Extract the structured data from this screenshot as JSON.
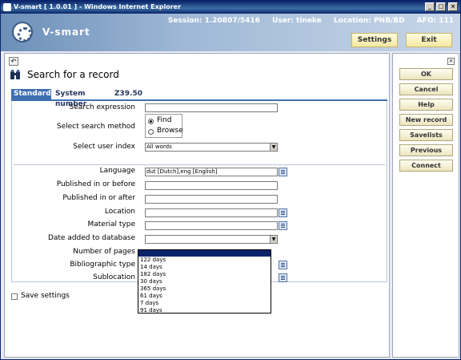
{
  "window": {
    "title": "V-smart [ 1.0.01 ] - Windows Internet Explorer"
  },
  "header": {
    "logo": "V-smart",
    "session": "Session: 1.20807/5416",
    "user": "User: tineke",
    "location": "Location: PNB/BD",
    "afo": "AFO: 111",
    "settings_label": "Settings",
    "exit_label": "Exit"
  },
  "page": {
    "title": "Search for a record"
  },
  "tabs": [
    {
      "label": "Standard",
      "active": true
    },
    {
      "label": "System number",
      "active": false
    },
    {
      "label": "Z39.50",
      "active": false
    }
  ],
  "form": {
    "search_expression_label": "Search expression",
    "search_expression_value": "",
    "search_method_label": "Select search method",
    "method_find": "Find",
    "method_browse": "Browse",
    "method_selected": "Find",
    "user_index_label": "Select user index",
    "user_index_value": "All words",
    "language_label": "Language",
    "language_value": "dut [Dutch],eng [English]",
    "published_before_label": "Published in or before",
    "published_after_label": "Published in or after",
    "location_label": "Location",
    "material_type_label": "Material type",
    "date_added_label": "Date added to database",
    "date_added_value": "",
    "num_pages_label": "Number of pages",
    "bibliographic_type_label": "Bibliographic type",
    "sublocation_label": "Sublocation"
  },
  "date_options": [
    "122 days",
    "14 days",
    "182 days",
    "30 days",
    "365 days",
    "61 days",
    "7 days",
    "91 days"
  ],
  "save_settings_label": "Save settings",
  "side_buttons": {
    "ok": "OK",
    "cancel": "Cancel",
    "help": "Help",
    "new_record": "New record",
    "savelists": "Savelists",
    "previous": "Previous",
    "connect": "Connect"
  },
  "colors": {
    "header_start": "#6c8fb8",
    "tab_active": "#3e6fb3",
    "button_bg": "#f5e7a0"
  }
}
